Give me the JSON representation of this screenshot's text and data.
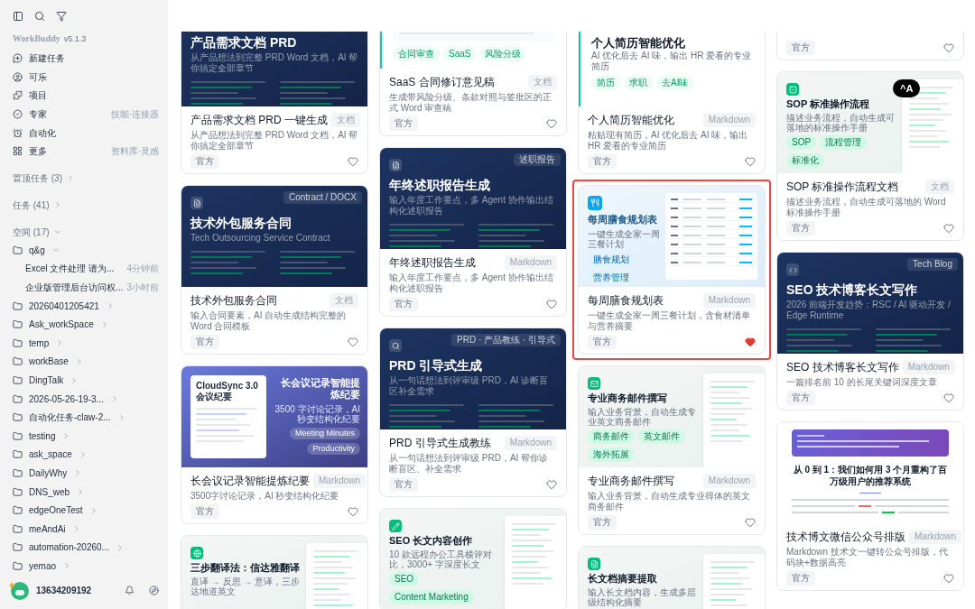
{
  "sidebar": {
    "app_name": "WorkBuddy",
    "version": "v5.1.3",
    "nav": [
      {
        "label": "新建任务"
      },
      {
        "label": "可乐"
      },
      {
        "label": "项目"
      },
      {
        "label": "专家",
        "hint": "技能·连接器"
      },
      {
        "label": "自动化"
      },
      {
        "label": "更多",
        "hint": "资料库·灵感"
      }
    ],
    "sections": [
      {
        "label": "置顶任务 (3)",
        "expanded": false
      },
      {
        "label": "任务 (41)",
        "expanded": false
      }
    ],
    "spaces": {
      "label": "空间 (17)",
      "expanded": true,
      "folders": [
        {
          "name": "q&g",
          "expanded": true,
          "children": [
            {
              "title": "Excel 文件处理 请为...",
              "time": "4分钟前"
            },
            {
              "title": "企业版管理后台访问权...",
              "time": "3小时前"
            }
          ]
        },
        {
          "name": "20260401205421",
          "expanded": false
        },
        {
          "name": "Ask_workSpace",
          "expanded": false
        },
        {
          "name": "temp",
          "expanded": false
        },
        {
          "name": "workBase",
          "expanded": false
        },
        {
          "name": "DingTalk",
          "expanded": false
        },
        {
          "name": "2026-05-26-19-3...",
          "expanded": false
        },
        {
          "name": "自动化任务-claw-2...",
          "expanded": false
        },
        {
          "name": "testing",
          "expanded": false
        },
        {
          "name": "ask_space",
          "expanded": false
        },
        {
          "name": "DailyWhy",
          "expanded": false
        },
        {
          "name": "DNS_web",
          "expanded": false
        },
        {
          "name": "edgeOneTest",
          "expanded": false
        },
        {
          "name": "meAndAi",
          "expanded": false
        },
        {
          "name": "automation-20260...",
          "expanded": false
        },
        {
          "name": "yemao",
          "expanded": false
        }
      ]
    },
    "user": {
      "phone": "13634209192"
    }
  },
  "overlay_badge": "^A",
  "columns": [
    [
      {
        "preview": {
          "kind": "dark",
          "title": "产品需求文档 PRD",
          "subtitle": "从产品想法到完整 PRD Word 文档，AI 帮你搞定全部章节"
        },
        "title": "产品需求文档 PRD 一键生成",
        "format": "文档",
        "description": "从产品想法到完整 PRD Word 文档，AI 帮你搞定全部章节",
        "tag": "官方",
        "favorite": false,
        "selected": false
      },
      {
        "preview": {
          "kind": "dark",
          "label": "Contract / DOCX",
          "title": "技术外包服务合同",
          "subtitle": "Tech Outsourcing Service Contract"
        },
        "title": "技术外包服务合同",
        "format": "文档",
        "description": "输入合同要素，AI 自动生成结构完整的 Word 合同模板",
        "tag": "官方",
        "favorite": false,
        "selected": false
      },
      {
        "preview": {
          "kind": "meeting",
          "doc_title": "CloudSync 3.0 会议纪要",
          "title": "长会议记录智能提炼纪要",
          "subtitle": "3500 字讨论记录，AI 秒变结构化纪要",
          "chips": [
            "Meeting Minutes",
            "Productivity"
          ]
        },
        "title": "长会议记录智能提炼纪要",
        "format": "Markdown",
        "description": "3500字讨论记录，AI 秒变结构化纪要",
        "tag": "官方",
        "favorite": false,
        "selected": false
      },
      {
        "preview": {
          "kind": "split",
          "title": "三步翻译法：信达雅翻译",
          "subtitle": "直译 → 反思 → 意译，三步达地道英文"
        }
      }
    ],
    [
      {
        "preview": {
          "kind": "sheet",
          "chips": [
            "合同审查",
            "SaaS",
            "风险分级"
          ]
        },
        "title": "SaaS 合同修订意见稿",
        "format": "文档",
        "description": "生成带风险分级、条款对照与签批区的正式 Word 审查稿",
        "tag": "官方",
        "favorite": false,
        "selected": false
      },
      {
        "preview": {
          "kind": "dark",
          "label": "述职报告",
          "title": "年终述职报告生成",
          "subtitle": "输入年度工作要点，多 Agent 协作输出结构化述职报告"
        },
        "title": "年终述职报告生成",
        "format": "Markdown",
        "description": "输入年度工作要点，多 Agent 协作输出结构化述职报告",
        "tag": "官方",
        "favorite": false,
        "selected": false
      },
      {
        "preview": {
          "kind": "dark",
          "label": "PRD · 产品教练 · 引导式",
          "title": "PRD 引导式生成",
          "subtitle": "从一句话想法到评审级 PRD，AI 诊断盲区补全需求"
        },
        "title": "PRD 引导式生成教练",
        "format": "Markdown",
        "description": "从一句话想法到评审级 PRD，AI 帮你诊断盲区、补全需求",
        "tag": "官方",
        "favorite": false,
        "selected": false
      },
      {
        "preview": {
          "kind": "split",
          "title": "SEO 长文内容创作",
          "subtitle": "10 款远程办公工具横评对比，3000+ 字深度长文",
          "chips": [
            "SEO",
            "Content Marketing"
          ]
        }
      }
    ],
    [
      {
        "preview": {
          "kind": "sheet",
          "title": "个人简历智能优化",
          "subtitle": "AI 优化后去 AI 味，输出 HR 爱看的专业简历",
          "chips": [
            "简历",
            "求职",
            "去AI味"
          ]
        },
        "title": "个人简历智能优化",
        "format": "Markdown",
        "description": "粘贴现有简历，AI 优化后去 AI 味，输出 HR 爱看的专业简历",
        "tag": "官方",
        "favorite": false,
        "selected": false
      },
      {
        "preview": {
          "kind": "meal",
          "title": "每周膳食规划表",
          "subtitle": "一键生成全家一周三餐计划",
          "chips": [
            "膳食规划",
            "营养管理"
          ]
        },
        "title": "每周膳食规划表",
        "format": "Markdown",
        "description": "一键生成全家一周三餐计划，含食材清单与营养摘要",
        "tag": "官方",
        "favorite": true,
        "selected": true
      },
      {
        "preview": {
          "kind": "split",
          "title": "专业商务邮件撰写",
          "subtitle": "输入业务背景，自动生成专业英文商务邮件",
          "chips": [
            "商务邮件",
            "英文邮件",
            "海外拓展"
          ]
        },
        "title": "专业商务邮件撰写",
        "format": "Markdown",
        "description": "输入业务背景，自动生成专业得体的英文商务邮件",
        "tag": "官方",
        "favorite": false,
        "selected": false
      },
      {
        "preview": {
          "kind": "split",
          "title": "长文档摘要提取",
          "subtitle": "输入长文档内容，生成多层级结构化摘要"
        }
      }
    ],
    [
      {
        "tag": "官方",
        "favorite": false,
        "selected": false
      },
      {
        "preview": {
          "kind": "split",
          "title": "SOP 标准操作流程",
          "subtitle": "描述业务流程，自动生成可落地的标准操作手册",
          "chips": [
            "SOP",
            "流程管理",
            "标准化"
          ]
        },
        "title": "SOP 标准操作流程文档",
        "format": "文档",
        "description": "描述业务流程，自动生成可落地的 Word 标准操作手册",
        "tag": "官方",
        "favorite": false,
        "selected": false
      },
      {
        "preview": {
          "kind": "dark",
          "label": "Tech Blog",
          "title": "SEO 技术博客长文写作",
          "subtitle": "2026 前端开发趋势：RSC / AI 驱动开发 / Edge Runtime"
        },
        "title": "SEO 技术博客长文写作",
        "format": "Markdown",
        "description": "一篇排名前 10 的长尾关键词深度文章",
        "tag": "官方",
        "favorite": false,
        "selected": false
      },
      {
        "preview": {
          "kind": "article",
          "heading": "从 0 到 1：我们如何用 3 个月重构了百万级用户的推荐系统"
        },
        "title": "技术博文微信公众号排版",
        "format": "Markdown",
        "description": "Markdown 技术文一键转公众号排版，代码块+数据高亮",
        "tag": "官方",
        "favorite": false,
        "selected": false
      }
    ]
  ]
}
